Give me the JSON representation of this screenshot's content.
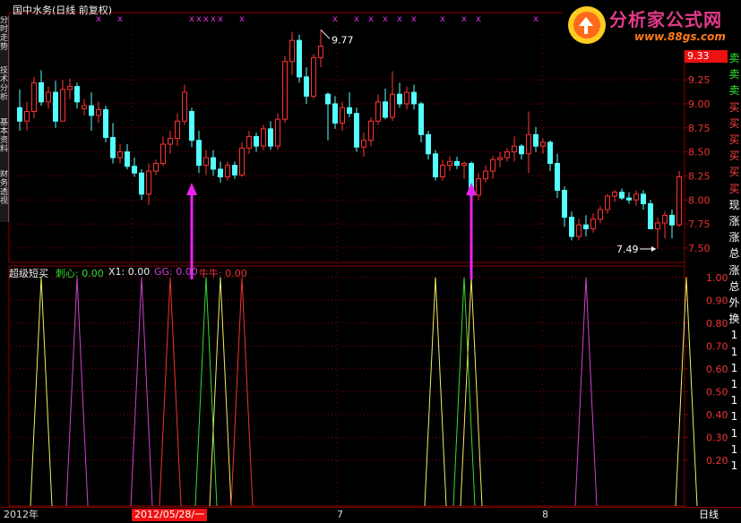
{
  "header": {
    "title": "国中水务(日线 前复权)"
  },
  "logo": {
    "text": "分析家公式网",
    "url": "www.88gs.com"
  },
  "left_tabs": [
    "分时走势",
    "技术分析",
    "基本资料",
    "财务透视"
  ],
  "price_badge": "9.33",
  "price_axis": {
    "ticks": [
      "9.25",
      "9.00",
      "8.75",
      "8.50",
      "8.25",
      "8.00",
      "7.75",
      "7.50"
    ],
    "ylim": [
      7.35,
      9.95
    ]
  },
  "annotations": {
    "high": "9.77",
    "low": "7.49"
  },
  "markers_x": [
    "x",
    "x",
    "x",
    "x",
    "x",
    "x",
    "x",
    "x",
    "x",
    "x",
    "x",
    "x",
    "x",
    "x",
    "x",
    "x",
    "x",
    "x"
  ],
  "indicator": {
    "name": "超级短买",
    "legend": [
      {
        "label": "刺心: 0.00",
        "color": "#33dd33"
      },
      {
        "label": "X1: 0.00",
        "color": "#eeeeee"
      },
      {
        "label": "GG: 0.00",
        "color": "#cc44cc"
      },
      {
        "label": "牛牛: 0.00",
        "color": "#ee3333"
      }
    ],
    "ticks": [
      "1.00",
      "0.90",
      "0.80",
      "0.70",
      "0.60",
      "0.50",
      "0.40",
      "0.30",
      "0.20"
    ]
  },
  "right_labels": [
    "卖",
    "卖",
    "卖",
    "买",
    "买",
    "买",
    "买",
    "买",
    "买",
    "现",
    "涨",
    "涨",
    "总",
    "涨",
    "总",
    "外",
    "换",
    "1",
    "1",
    "1",
    "1",
    "1",
    "1",
    "1",
    "1",
    "1"
  ],
  "bottom": {
    "date1": "2012年",
    "date2": "2012/05/28/一",
    "m7": "7",
    "m8": "8",
    "period": "日线"
  },
  "colors": {
    "up": "#ff3333",
    "down": "#54ffff",
    "grid": "#8a0000",
    "marker": "#dd33dd",
    "arrow": "#ee22ee"
  },
  "chart_data": {
    "type": "candlestick",
    "title": "国中水务(日线 前复权)",
    "ylim": [
      7.35,
      9.95
    ],
    "candles": [
      {
        "o": 8.96,
        "h": 9.15,
        "l": 8.72,
        "c": 8.82
      },
      {
        "o": 8.82,
        "h": 9.02,
        "l": 8.72,
        "c": 8.92
      },
      {
        "o": 8.92,
        "h": 9.28,
        "l": 8.85,
        "c": 9.22
      },
      {
        "o": 9.22,
        "h": 9.35,
        "l": 8.98,
        "c": 9.02
      },
      {
        "o": 9.02,
        "h": 9.18,
        "l": 8.95,
        "c": 9.12
      },
      {
        "o": 9.12,
        "h": 9.24,
        "l": 8.75,
        "c": 8.82
      },
      {
        "o": 8.82,
        "h": 9.25,
        "l": 8.82,
        "c": 9.15
      },
      {
        "o": 9.15,
        "h": 9.26,
        "l": 9.05,
        "c": 9.18
      },
      {
        "o": 9.18,
        "h": 9.22,
        "l": 8.95,
        "c": 9.02
      },
      {
        "o": 8.95,
        "h": 9.05,
        "l": 8.88,
        "c": 8.98
      },
      {
        "o": 8.98,
        "h": 9.12,
        "l": 8.72,
        "c": 8.88
      },
      {
        "o": 8.88,
        "h": 9.02,
        "l": 8.8,
        "c": 8.94
      },
      {
        "o": 8.94,
        "h": 8.98,
        "l": 8.6,
        "c": 8.65
      },
      {
        "o": 8.65,
        "h": 8.8,
        "l": 8.38,
        "c": 8.44
      },
      {
        "o": 8.44,
        "h": 8.58,
        "l": 8.38,
        "c": 8.5
      },
      {
        "o": 8.5,
        "h": 8.58,
        "l": 8.32,
        "c": 8.35
      },
      {
        "o": 8.35,
        "h": 8.44,
        "l": 8.24,
        "c": 8.28
      },
      {
        "o": 8.28,
        "h": 8.32,
        "l": 8.0,
        "c": 8.06
      },
      {
        "o": 8.06,
        "h": 8.38,
        "l": 7.95,
        "c": 8.3
      },
      {
        "o": 8.3,
        "h": 8.42,
        "l": 8.26,
        "c": 8.38
      },
      {
        "o": 8.38,
        "h": 8.66,
        "l": 8.35,
        "c": 8.58
      },
      {
        "o": 8.58,
        "h": 8.72,
        "l": 8.48,
        "c": 8.64
      },
      {
        "o": 8.64,
        "h": 8.9,
        "l": 8.56,
        "c": 8.82
      },
      {
        "o": 8.82,
        "h": 9.2,
        "l": 8.78,
        "c": 9.12
      },
      {
        "o": 8.92,
        "h": 8.96,
        "l": 8.55,
        "c": 8.62
      },
      {
        "o": 8.62,
        "h": 8.72,
        "l": 8.28,
        "c": 8.36
      },
      {
        "o": 8.36,
        "h": 8.52,
        "l": 8.26,
        "c": 8.44
      },
      {
        "o": 8.44,
        "h": 8.52,
        "l": 8.25,
        "c": 8.32
      },
      {
        "o": 8.32,
        "h": 8.4,
        "l": 8.18,
        "c": 8.24
      },
      {
        "o": 8.24,
        "h": 8.4,
        "l": 8.2,
        "c": 8.36
      },
      {
        "o": 8.36,
        "h": 8.4,
        "l": 8.22,
        "c": 8.26
      },
      {
        "o": 8.26,
        "h": 8.6,
        "l": 8.24,
        "c": 8.54
      },
      {
        "o": 8.54,
        "h": 8.72,
        "l": 8.48,
        "c": 8.66
      },
      {
        "o": 8.66,
        "h": 8.7,
        "l": 8.5,
        "c": 8.56
      },
      {
        "o": 8.56,
        "h": 8.78,
        "l": 8.52,
        "c": 8.74
      },
      {
        "o": 8.74,
        "h": 8.82,
        "l": 8.52,
        "c": 8.56
      },
      {
        "o": 8.56,
        "h": 8.9,
        "l": 8.52,
        "c": 8.84
      },
      {
        "o": 8.84,
        "h": 9.5,
        "l": 8.8,
        "c": 9.44
      },
      {
        "o": 9.44,
        "h": 9.75,
        "l": 9.3,
        "c": 9.66
      },
      {
        "o": 9.66,
        "h": 9.72,
        "l": 9.22,
        "c": 9.28
      },
      {
        "o": 9.28,
        "h": 9.38,
        "l": 9.0,
        "c": 9.08
      },
      {
        "o": 9.08,
        "h": 9.52,
        "l": 9.05,
        "c": 9.48
      },
      {
        "o": 9.48,
        "h": 9.77,
        "l": 9.38,
        "c": 9.6
      },
      {
        "o": 9.1,
        "h": 9.12,
        "l": 8.62,
        "c": 9.0
      },
      {
        "o": 9.0,
        "h": 9.08,
        "l": 8.74,
        "c": 8.8
      },
      {
        "o": 8.8,
        "h": 9.02,
        "l": 8.72,
        "c": 8.96
      },
      {
        "o": 8.96,
        "h": 9.12,
        "l": 8.86,
        "c": 8.9
      },
      {
        "o": 8.9,
        "h": 8.96,
        "l": 8.5,
        "c": 8.55
      },
      {
        "o": 8.55,
        "h": 8.7,
        "l": 8.45,
        "c": 8.62
      },
      {
        "o": 8.62,
        "h": 8.86,
        "l": 8.56,
        "c": 8.82
      },
      {
        "o": 8.82,
        "h": 9.1,
        "l": 8.78,
        "c": 9.02
      },
      {
        "o": 9.02,
        "h": 9.16,
        "l": 8.84,
        "c": 8.86
      },
      {
        "o": 8.86,
        "h": 9.34,
        "l": 8.82,
        "c": 9.1
      },
      {
        "o": 9.1,
        "h": 9.22,
        "l": 8.96,
        "c": 9.0
      },
      {
        "o": 9.0,
        "h": 9.18,
        "l": 8.94,
        "c": 9.12
      },
      {
        "o": 9.12,
        "h": 9.2,
        "l": 8.94,
        "c": 9.0
      },
      {
        "o": 9.0,
        "h": 9.02,
        "l": 8.6,
        "c": 8.68
      },
      {
        "o": 8.68,
        "h": 8.72,
        "l": 8.42,
        "c": 8.48
      },
      {
        "o": 8.48,
        "h": 8.52,
        "l": 8.2,
        "c": 8.24
      },
      {
        "o": 8.24,
        "h": 8.42,
        "l": 8.2,
        "c": 8.36
      },
      {
        "o": 8.36,
        "h": 8.45,
        "l": 8.3,
        "c": 8.4
      },
      {
        "o": 8.4,
        "h": 8.45,
        "l": 8.32,
        "c": 8.36
      },
      {
        "o": 8.36,
        "h": 8.4,
        "l": 8.22,
        "c": 8.38
      },
      {
        "o": 8.38,
        "h": 8.4,
        "l": 8.0,
        "c": 8.05
      },
      {
        "o": 8.05,
        "h": 8.28,
        "l": 8.0,
        "c": 8.22
      },
      {
        "o": 8.22,
        "h": 8.36,
        "l": 8.18,
        "c": 8.3
      },
      {
        "o": 8.3,
        "h": 8.46,
        "l": 8.22,
        "c": 8.42
      },
      {
        "o": 8.42,
        "h": 8.5,
        "l": 8.34,
        "c": 8.44
      },
      {
        "o": 8.44,
        "h": 8.54,
        "l": 8.4,
        "c": 8.5
      },
      {
        "o": 8.5,
        "h": 8.66,
        "l": 8.4,
        "c": 8.56
      },
      {
        "o": 8.56,
        "h": 8.58,
        "l": 8.42,
        "c": 8.48
      },
      {
        "o": 8.48,
        "h": 8.92,
        "l": 8.28,
        "c": 8.68
      },
      {
        "o": 8.68,
        "h": 8.76,
        "l": 8.5,
        "c": 8.56
      },
      {
        "o": 8.56,
        "h": 8.64,
        "l": 8.48,
        "c": 8.6
      },
      {
        "o": 8.6,
        "h": 8.62,
        "l": 8.3,
        "c": 8.38
      },
      {
        "o": 8.38,
        "h": 8.48,
        "l": 8.02,
        "c": 8.1
      },
      {
        "o": 8.1,
        "h": 8.14,
        "l": 7.72,
        "c": 7.82
      },
      {
        "o": 7.82,
        "h": 7.88,
        "l": 7.58,
        "c": 7.62
      },
      {
        "o": 7.62,
        "h": 7.8,
        "l": 7.58,
        "c": 7.74
      },
      {
        "o": 7.74,
        "h": 7.84,
        "l": 7.62,
        "c": 7.7
      },
      {
        "o": 7.7,
        "h": 7.86,
        "l": 7.66,
        "c": 7.8
      },
      {
        "o": 7.8,
        "h": 7.94,
        "l": 7.76,
        "c": 7.9
      },
      {
        "o": 7.9,
        "h": 8.06,
        "l": 7.86,
        "c": 8.04
      },
      {
        "o": 8.04,
        "h": 8.1,
        "l": 7.98,
        "c": 8.08
      },
      {
        "o": 8.08,
        "h": 8.12,
        "l": 8.0,
        "c": 8.02
      },
      {
        "o": 8.02,
        "h": 8.08,
        "l": 7.96,
        "c": 8.0
      },
      {
        "o": 8.0,
        "h": 8.1,
        "l": 7.94,
        "c": 8.06
      },
      {
        "o": 8.06,
        "h": 8.1,
        "l": 7.9,
        "c": 7.96
      },
      {
        "o": 7.96,
        "h": 8.0,
        "l": 7.72,
        "c": 7.7
      },
      {
        "o": 7.7,
        "h": 7.82,
        "l": 7.49,
        "c": 7.76
      },
      {
        "o": 7.76,
        "h": 7.88,
        "l": 7.6,
        "c": 7.84
      },
      {
        "o": 7.84,
        "h": 7.9,
        "l": 7.6,
        "c": 7.74
      },
      {
        "o": 7.74,
        "h": 8.3,
        "l": 7.72,
        "c": 8.24
      }
    ],
    "buy_arrows_at_index": [
      24,
      63
    ],
    "indicator_spikes": [
      {
        "series": "X1",
        "at": 3
      },
      {
        "series": "GG",
        "at": 8
      },
      {
        "series": "GG",
        "at": 17
      },
      {
        "series": "牛牛",
        "at": 21
      },
      {
        "series": "刺心",
        "at": 26
      },
      {
        "series": "X1",
        "at": 28
      },
      {
        "series": "牛牛",
        "at": 31
      },
      {
        "series": "X1",
        "at": 58
      },
      {
        "series": "刺心",
        "at": 62
      },
      {
        "series": "X1",
        "at": 63
      },
      {
        "series": "GG",
        "at": 79
      },
      {
        "series": "X1",
        "at": 93
      }
    ],
    "indicator_ylim": [
      0,
      1.05
    ]
  }
}
